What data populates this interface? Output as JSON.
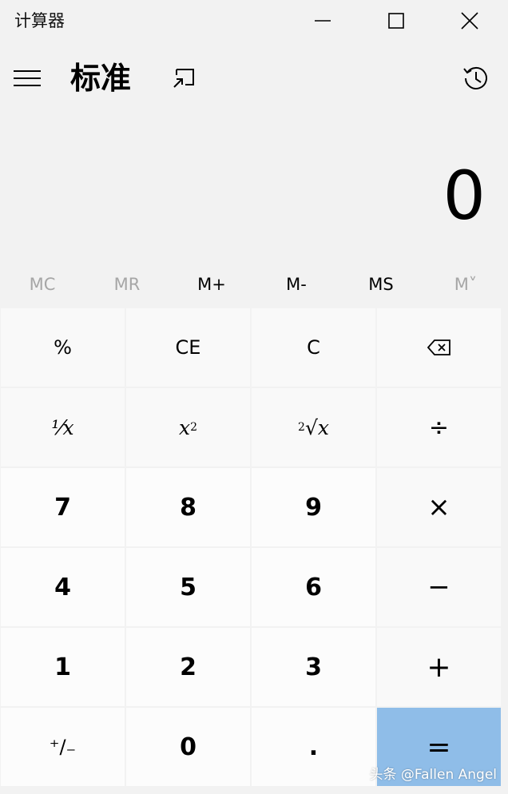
{
  "window": {
    "title": "计算器",
    "minimize_icon": "minimize-icon",
    "maximize_icon": "maximize-icon",
    "close_icon": "close-icon"
  },
  "header": {
    "menu_icon": "hamburger-menu-icon",
    "mode": "标准",
    "keep_on_top_icon": "keep-on-top-icon",
    "history_icon": "history-icon"
  },
  "display": {
    "value": "0"
  },
  "memory": {
    "buttons": [
      {
        "label": "MC",
        "state": "disabled"
      },
      {
        "label": "MR",
        "state": "disabled"
      },
      {
        "label": "M+",
        "state": "enabled"
      },
      {
        "label": "M-",
        "state": "enabled"
      },
      {
        "label": "MS",
        "state": "enabled"
      },
      {
        "label": "M˅",
        "state": "disabled"
      }
    ]
  },
  "keypad": {
    "percent": "%",
    "ce": "CE",
    "c": "C",
    "backspace_icon": "backspace-icon",
    "reciprocal": "⅟x",
    "square_base": "x",
    "square_exp": "2",
    "sqrt_index": "2",
    "sqrt_radical": "√x",
    "divide": "÷",
    "seven": "7",
    "eight": "8",
    "nine": "9",
    "multiply": "×",
    "four": "4",
    "five": "5",
    "six": "6",
    "minus": "−",
    "one": "1",
    "two": "2",
    "three": "3",
    "plus": "+",
    "negate": "⁺∕₋",
    "zero": "0",
    "decimal": ".",
    "equals": "="
  },
  "colors": {
    "background": "#f2f2f2",
    "key_light": "#f9f9f9",
    "key_number": "#fcfcfc",
    "equals_accent": "#8fbde8",
    "disabled_text": "#a6a6a6"
  },
  "watermark": "头条 @Fallen Angel"
}
